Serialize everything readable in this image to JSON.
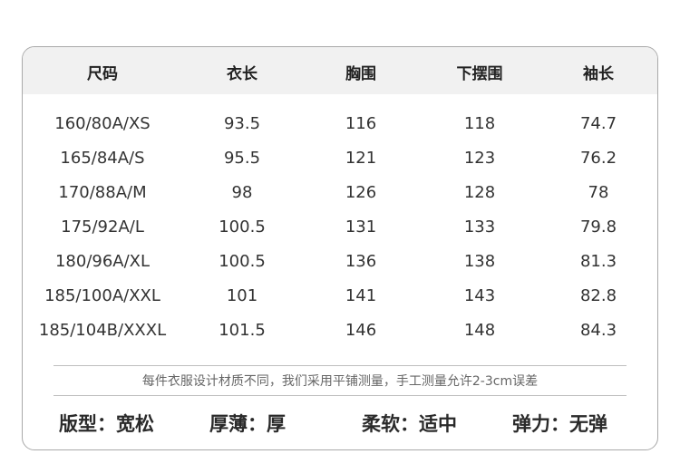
{
  "table": {
    "headers": [
      "尺码",
      "衣长",
      "胸围",
      "下摆围",
      "袖长"
    ],
    "rows": [
      [
        "160/80A/XS",
        "93.5",
        "116",
        "118",
        "74.7"
      ],
      [
        "165/84A/S",
        "95.5",
        "121",
        "123",
        "76.2"
      ],
      [
        "170/88A/M",
        "98",
        "126",
        "128",
        "78"
      ],
      [
        "175/92A/L",
        "100.5",
        "131",
        "133",
        "79.8"
      ],
      [
        "180/96A/XL",
        "100.5",
        "136",
        "138",
        "81.3"
      ],
      [
        "185/100A/XXL",
        "101",
        "141",
        "143",
        "82.8"
      ],
      [
        "185/104B/XXXL",
        "101.5",
        "146",
        "148",
        "84.3"
      ]
    ]
  },
  "note": "每件衣服设计材质不同，我们采用平铺测量，手工测量允许2-3cm误差",
  "properties": [
    "版型：宽松",
    "厚薄：厚",
    "柔软：适中",
    "弹力：无弹"
  ],
  "colors": {
    "header_bg": "#f1f1f1",
    "border": "#a9a9a9",
    "divider": "#bfbfbf",
    "note_text": "#666666"
  }
}
